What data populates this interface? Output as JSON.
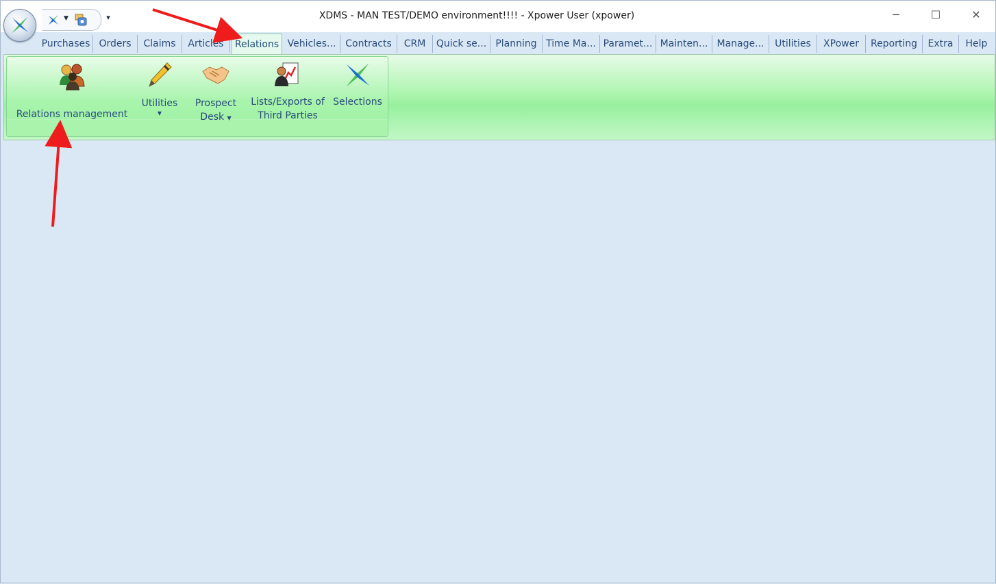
{
  "window": {
    "title": "XDMS - MAN TEST/DEMO environment!!!! - Xpower User (xpower)",
    "controls": {
      "minimize": "─",
      "maximize": "☐",
      "close": "✕"
    }
  },
  "quick_access": {
    "customize_glyph": "▾"
  },
  "tabs": [
    "Purchases",
    "Orders",
    "Claims",
    "Articles",
    "Relations",
    "Vehicles...",
    "Contracts",
    "CRM",
    "Quick se...",
    "Planning",
    "Time Ma...",
    "Paramet...",
    "Mainten...",
    "Manage...",
    "Utilities",
    "XPower",
    "Reporting",
    "Extra",
    "Help"
  ],
  "active_tab": "Relations",
  "ribbon": {
    "buttons": {
      "relations_management": "Relations management",
      "utilities": "Utilities",
      "prospect_desk_1": "Prospect",
      "prospect_desk_2": "Desk",
      "lists_exports_1": "Lists/Exports of",
      "lists_exports_2": "Third Parties",
      "selections": "Selections"
    },
    "dropdown_caret": "▼"
  },
  "colors": {
    "accent_green": "#a9f4ad",
    "background": "#dae8f5",
    "annotation": "#ee1c1c"
  }
}
